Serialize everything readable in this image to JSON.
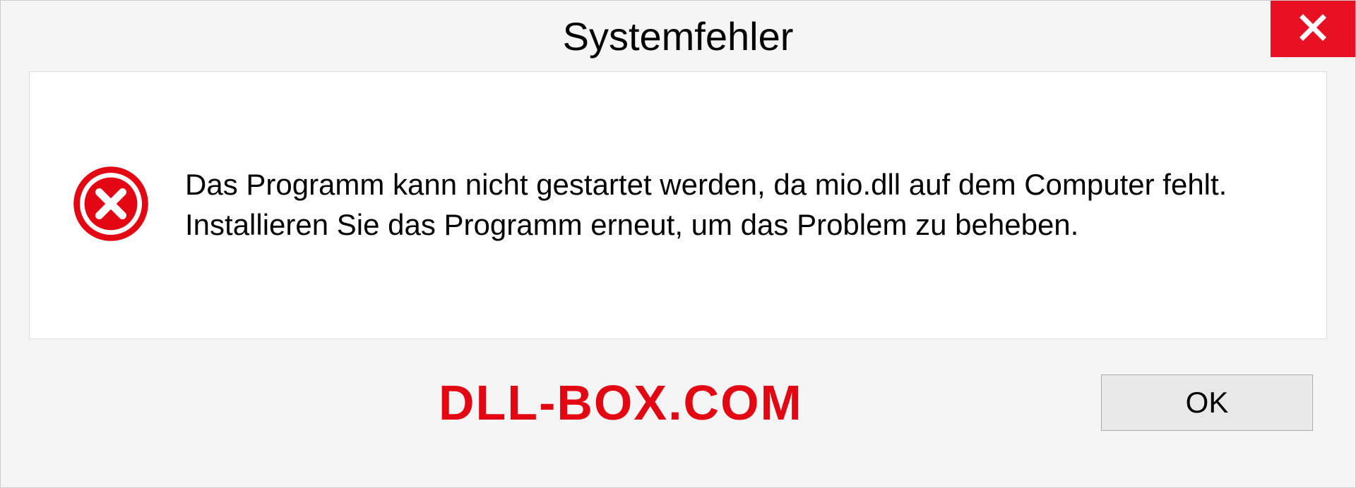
{
  "dialog": {
    "title": "Systemfehler",
    "message": "Das Programm kann nicht gestartet werden, da mio.dll auf dem Computer fehlt. Installieren Sie das Programm erneut, um das Problem zu beheben.",
    "ok_label": "OK"
  },
  "watermark": "DLL-BOX.COM",
  "colors": {
    "close_bg": "#e81123",
    "error_red": "#e30613"
  }
}
